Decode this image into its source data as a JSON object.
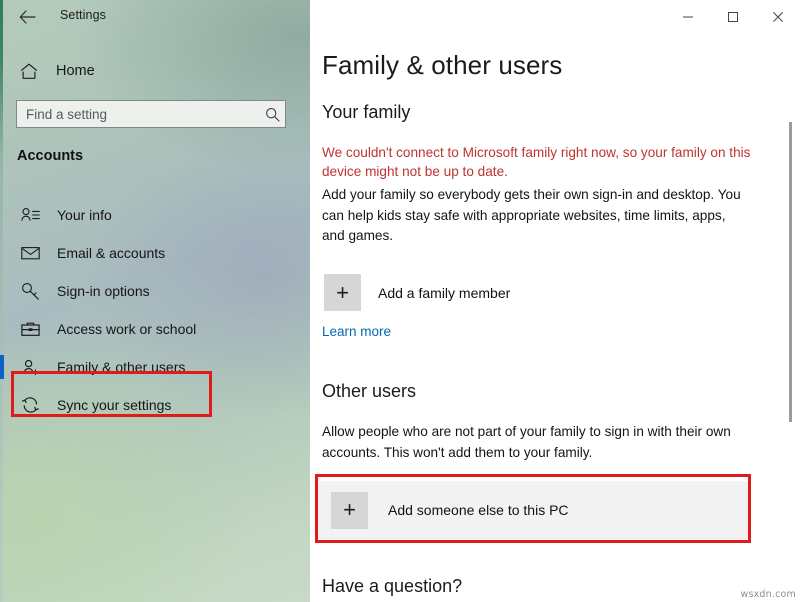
{
  "window": {
    "app_title": "Settings",
    "back_icon": "back-arrow-icon",
    "minimize_label": "—",
    "maximize_label": "☐",
    "close_label": "✕"
  },
  "sidebar": {
    "home": {
      "label": "Home",
      "icon": "home-icon"
    },
    "search": {
      "placeholder": "Find a setting",
      "value": "",
      "icon": "search-icon"
    },
    "section_heading": "Accounts",
    "items": [
      {
        "label": "Your info",
        "icon": "user-info-icon",
        "selected": false
      },
      {
        "label": "Email & accounts",
        "icon": "envelope-icon",
        "selected": false
      },
      {
        "label": "Sign-in options",
        "icon": "key-icon",
        "selected": false
      },
      {
        "label": "Access work or school",
        "icon": "briefcase-icon",
        "selected": false
      },
      {
        "label": "Family & other users",
        "icon": "add-person-icon",
        "selected": true
      },
      {
        "label": "Sync your settings",
        "icon": "sync-icon",
        "selected": false
      }
    ]
  },
  "main": {
    "page_title": "Family & other users",
    "your_family": {
      "heading": "Your family",
      "error_text": "We couldn't connect to Microsoft family right now, so your family on this device might not be up to date.",
      "description": "Add your family so everybody gets their own sign-in and desktop. You can help kids stay safe with appropriate websites, time limits, apps, and games.",
      "add_member_label": "Add a family member",
      "add_member_icon": "plus-icon",
      "learn_more_label": "Learn more"
    },
    "other_users": {
      "heading": "Other users",
      "description": "Allow people who are not part of your family to sign in with their own accounts. This won't add them to your family.",
      "add_someone_label": "Add someone else to this PC",
      "add_someone_icon": "plus-icon"
    },
    "have_question_heading": "Have a question?"
  },
  "colors": {
    "accent_blue": "#0a64c8",
    "error_red": "#bf3330",
    "link_blue": "#0468b4",
    "annotation_red": "#e01b1b",
    "row_highlight": "#f2f2f2"
  },
  "watermark": "wsxdn.com"
}
